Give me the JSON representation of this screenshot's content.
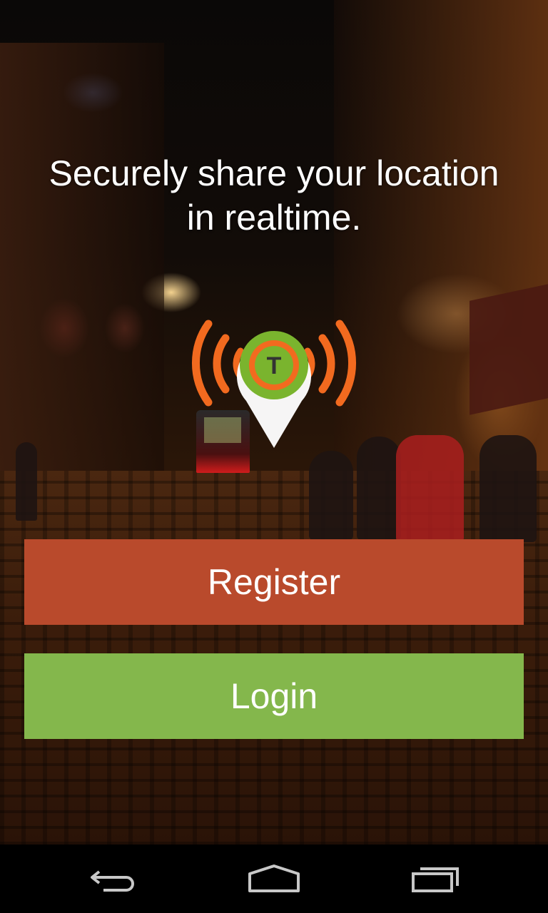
{
  "tagline": {
    "line1": "Securely share your location",
    "line2": "in realtime."
  },
  "logo": {
    "icon": "location-pin-broadcast-icon",
    "letter": "T",
    "colors": {
      "signal_waves": "#f26a1f",
      "ring": "#7ab42e",
      "pin": "#ffffff",
      "letter": "#333333"
    }
  },
  "buttons": {
    "register_label": "Register",
    "login_label": "Login"
  },
  "navbar": {
    "back_icon": "back-icon",
    "home_icon": "home-icon",
    "recents_icon": "recent-apps-icon"
  },
  "colors": {
    "register": "#b94a2c",
    "login": "#84b74c",
    "text": "#ffffff",
    "navbar": "#000000"
  }
}
